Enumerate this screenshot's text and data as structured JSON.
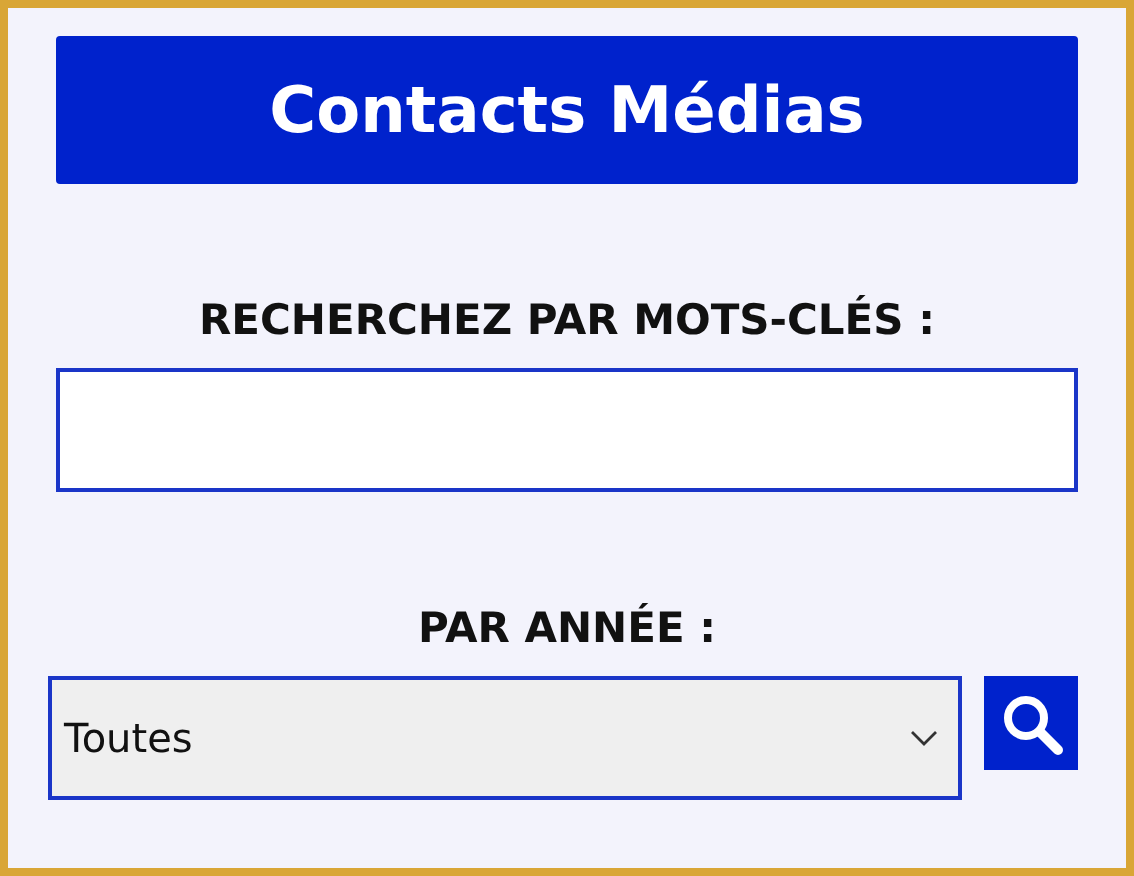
{
  "header": {
    "title": "Contacts Médias"
  },
  "keyword_search": {
    "label": "RECHERCHEZ PAR MOTS-CLÉS :"
  },
  "year_filter": {
    "label": "PAR ANNÉE :",
    "value": "Toutes"
  }
}
